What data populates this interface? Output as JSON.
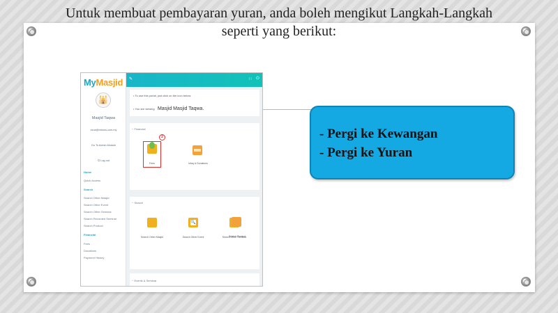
{
  "slide": {
    "title_line1": "Untuk membuat pembayaran yuran, anda boleh mengikut Langkah-Langkah",
    "title_line2": "seperti yang berikut:"
  },
  "callout": {
    "line1": "- Pergi ke Kewangan",
    "line2": "- Pergi ke Yuran"
  },
  "screenshot": {
    "logo_my": "My",
    "logo_masjid": "Masjid",
    "masjid_name": "Masjid Taqwa",
    "email": "ezue@mhuns.com.my",
    "admin_link": "Go To Admin Module",
    "logout": "Log out",
    "nav": [
      {
        "label": "Home",
        "section": true
      },
      {
        "label": "Quick Access",
        "section": false
      },
      {
        "label": "Search",
        "section": true
      },
      {
        "label": "Search Other Masjid",
        "section": false
      },
      {
        "label": "Search Other Event",
        "section": false
      },
      {
        "label": "Search Other Seminar",
        "section": false
      },
      {
        "label": "Search Recorded Seminar",
        "section": false
      },
      {
        "label": "Search Product",
        "section": false
      },
      {
        "label": "Financial",
        "section": true
      },
      {
        "label": "Fees",
        "section": false
      },
      {
        "label": "Donations",
        "section": false
      },
      {
        "label": "Payment History",
        "section": false
      }
    ],
    "info_line1": "To use this portal, just click on the icon below.",
    "info_line2_prefix": "You are viewing",
    "info_line2_value": "Masjid Masjid Taqwa.",
    "financial_header": "Financial",
    "financial_tiles": [
      "Fees",
      "Infaq & Donations"
    ],
    "step_number": "2",
    "search_header": "Search",
    "search_tiles": [
      "Search Other Masjid",
      "Search Other Event",
      "Search Other Seminar",
      "Search Product"
    ],
    "events_header": "Events & Seminar"
  },
  "colors": {
    "accent": "#18b6c9",
    "callout_bg": "#14a9e2",
    "highlight": "#e0302e"
  }
}
